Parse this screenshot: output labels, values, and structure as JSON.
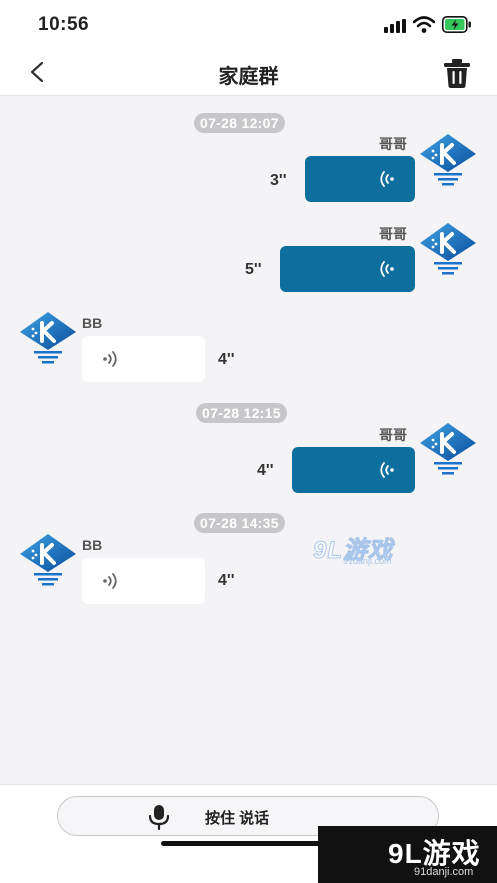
{
  "status_bar": {
    "time": "10:56"
  },
  "nav": {
    "title": "家庭群"
  },
  "messages": [
    {
      "timestamp": "07-28 12:07"
    },
    {
      "sender": "哥哥",
      "duration": "3''",
      "direction": "out"
    },
    {
      "sender": "哥哥",
      "duration": "5''",
      "direction": "out"
    },
    {
      "sender": "BB",
      "duration": "4''",
      "direction": "in"
    },
    {
      "timestamp": "07-28 12:15"
    },
    {
      "sender": "哥哥",
      "duration": "4''",
      "direction": "out"
    },
    {
      "timestamp": "07-28 14:35"
    },
    {
      "sender": "BB",
      "duration": "4''",
      "direction": "in"
    }
  ],
  "bottom": {
    "talk_label": "按住 说话"
  },
  "watermark": {
    "brand": "9L游戏",
    "domain": "91danji.com"
  },
  "colors": {
    "outgoing_bubble": "#0e6f9f",
    "incoming_bubble": "#ffffff",
    "timestamp_pill": "#c7c7ca",
    "background": "#f4f4f6"
  },
  "icons": {
    "back": "chevron-left-icon",
    "delete": "trash-icon",
    "voice_out": "sound-wave-left-icon",
    "voice_in": "sound-wave-right-icon",
    "mic": "microphone-icon",
    "avatar": "k-logo-diamond-icon"
  }
}
